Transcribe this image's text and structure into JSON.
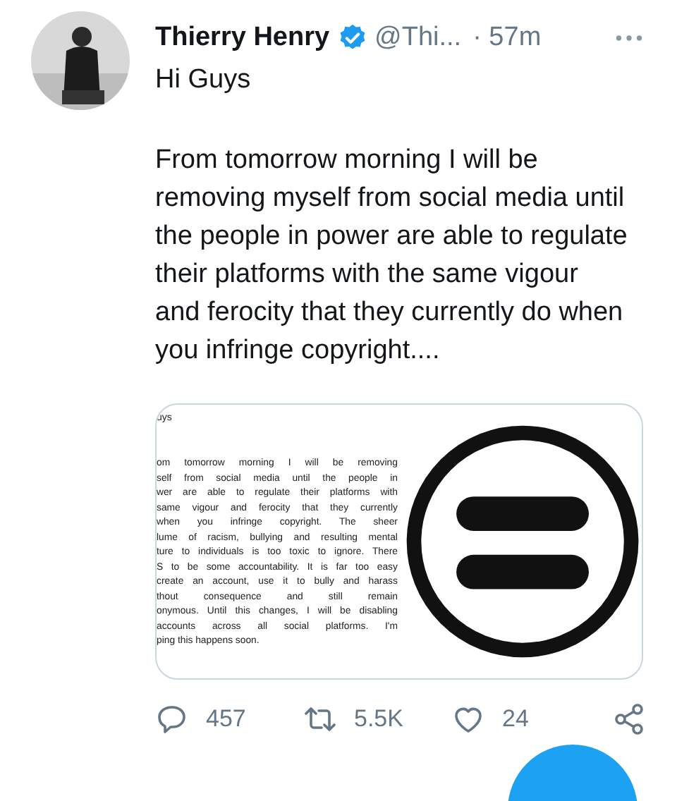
{
  "tweet": {
    "author": {
      "name": "Thierry Henry",
      "verified": true,
      "handle": "@Thi...",
      "time": "· 57m"
    },
    "greeting": "Hi Guys",
    "text": "From tomorrow morning I will be removing myself from social media until the people in power are able to regulate their platforms with the same vigour and ferocity that they currently do when you infringe copyright....",
    "attachment": {
      "heading": "uys",
      "lines": [
        "om tomorrow morning I will be removing",
        "self from social media until the people in",
        "wer are able to regulate their platforms with",
        "same vigour and ferocity that they currently",
        "when you infringe copyright. The sheer",
        "lume of racism, bullying and resulting mental",
        "ture to individuals is too toxic to ignore. There",
        "S to be some accountability. It is far too easy",
        "create an account, use it to bully and harass",
        "thout consequence and still remain",
        "onymous. Until this changes, I will be disabling",
        "accounts across all social platforms. I'm",
        "ping this happens soon."
      ]
    },
    "actions": [
      {
        "kind": "reply",
        "count": "457"
      },
      {
        "kind": "retweet",
        "count": "5.5K"
      },
      {
        "kind": "like",
        "count": "24"
      },
      {
        "kind": "share"
      }
    ]
  }
}
